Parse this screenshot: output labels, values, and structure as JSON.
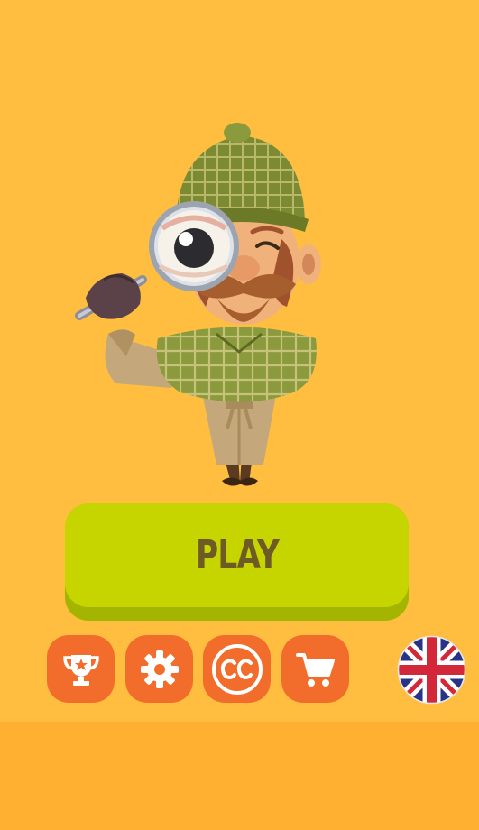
{
  "menu": {
    "play_label": "PLAY",
    "buttons": [
      {
        "name": "trophy-button",
        "icon": "trophy-icon"
      },
      {
        "name": "settings-button",
        "icon": "gear-icon"
      },
      {
        "name": "credits-button",
        "icon": "cc-icon"
      },
      {
        "name": "shop-button",
        "icon": "cart-icon"
      }
    ],
    "language": {
      "icon": "uk-flag-icon"
    }
  },
  "colors": {
    "background": "#FFBE3F",
    "bottom_band": "#FFB030",
    "play_button": "#C6D400",
    "play_button_shadow": "#A3B500",
    "play_text": "#6E5A24",
    "icon_button": "#F26D2B"
  },
  "mascot": {
    "icon": "detective-mascot"
  }
}
